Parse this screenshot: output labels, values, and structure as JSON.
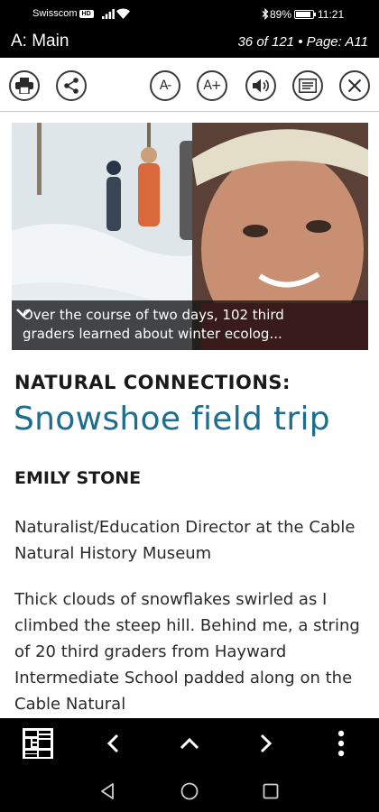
{
  "status_bar": {
    "carrier": "Swisscom",
    "network_badge": "HD",
    "battery_percent": "89%",
    "time": "11:21"
  },
  "title_bar": {
    "section": "A: Main",
    "page_info": "36 of 121 • Page: A11"
  },
  "toolbar": {
    "font_smaller_label": "A-",
    "font_larger_label": "A+",
    "icons": [
      "print-icon",
      "share-icon",
      "font-decrease-icon",
      "font-increase-icon",
      "speaker-icon",
      "text-view-icon",
      "close-icon"
    ]
  },
  "article": {
    "photo_caption": "Over the course of two days, 102 third graders learned about winter ecolog...",
    "kicker": "NATURAL CONNECTIONS:",
    "headline": "Snowshoe field trip",
    "byline": "EMILY STONE",
    "author_bio": "Naturalist/Education Director at the Cable Natural History Museum",
    "body": "Thick clouds of snowflakes swirled as I climbed the steep hill. Behind me, a string of 20 third graders from Hayward Intermediate School padded along on the Cable Natural"
  },
  "bottom_bar": {
    "icons": [
      "page-thumbnails-icon",
      "previous-article-icon",
      "up-icon",
      "next-article-icon",
      "more-options-icon"
    ]
  },
  "nav_bar": {
    "icons": [
      "back-icon",
      "home-icon",
      "recents-icon"
    ]
  },
  "colors": {
    "headline": "#1d6d8f",
    "background": "#ffffff",
    "chrome": "#000000"
  }
}
